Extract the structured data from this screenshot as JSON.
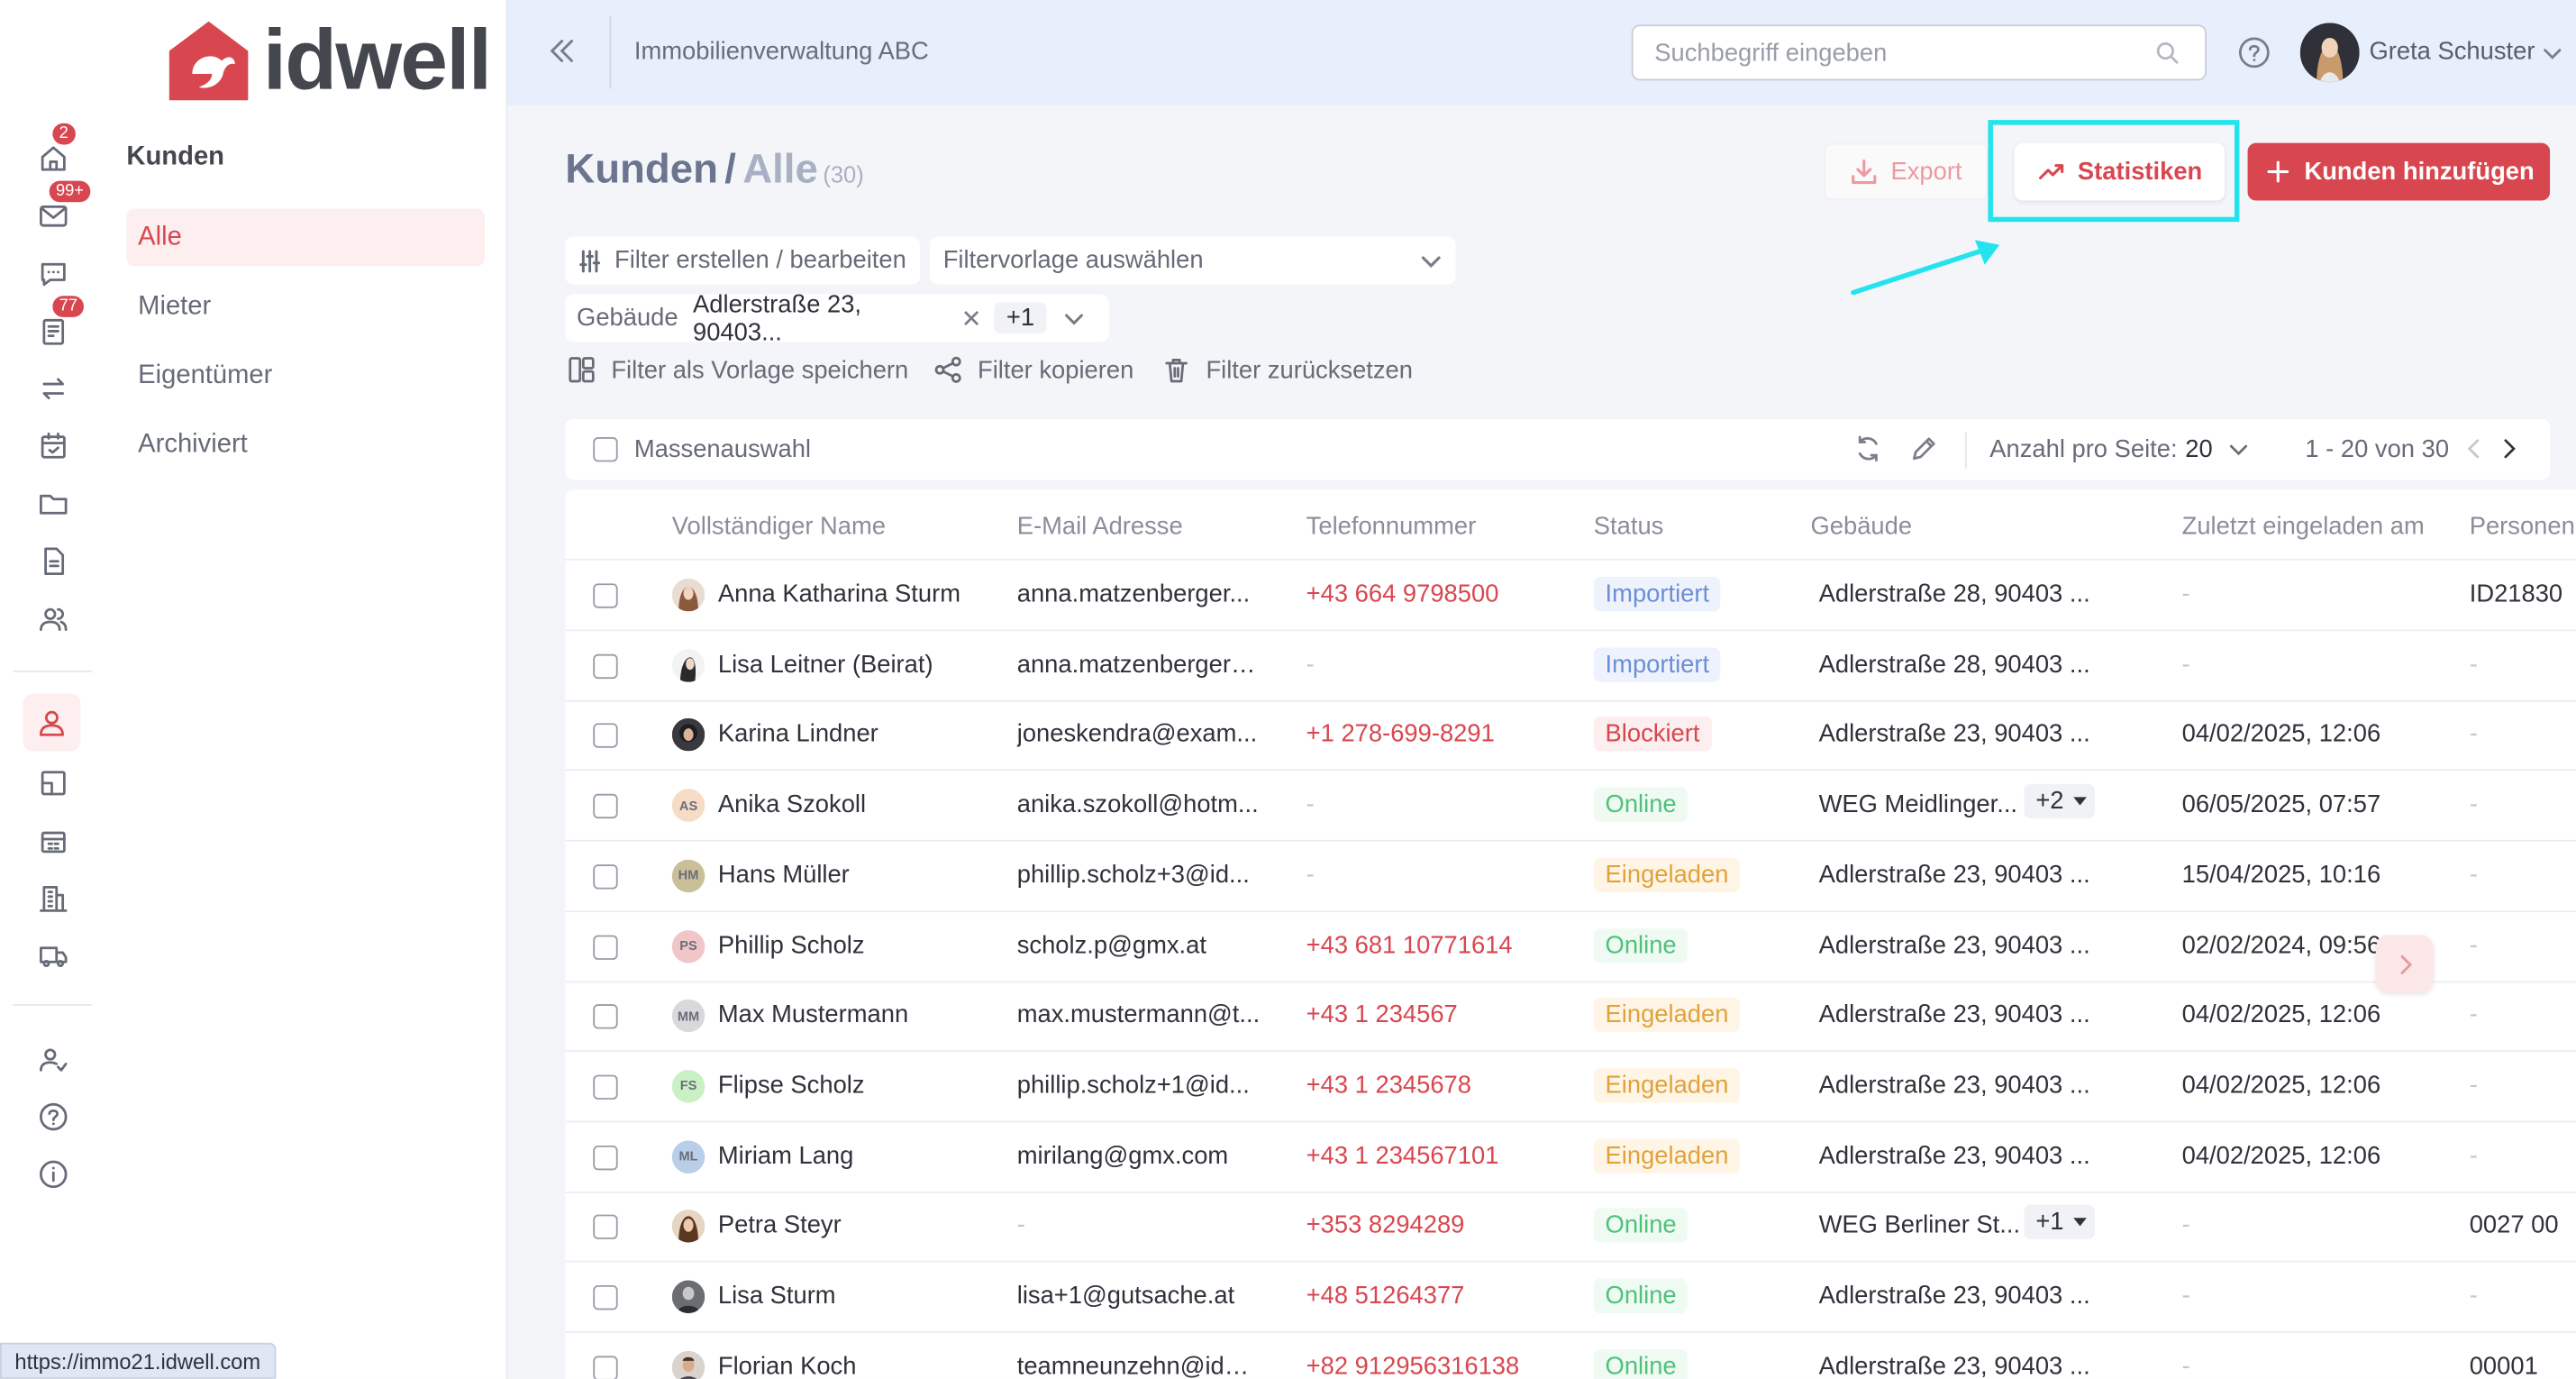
{
  "brand": {
    "name": "idwell",
    "primary": "#d8474f",
    "highlight": "#22e3ee"
  },
  "rail": {
    "badges": {
      "home": "2",
      "mail": "99+",
      "tickets": "77"
    }
  },
  "subnav": {
    "title": "Kunden",
    "items": [
      {
        "label": "Alle",
        "active": true
      },
      {
        "label": "Mieter",
        "active": false
      },
      {
        "label": "Eigentümer",
        "active": false
      },
      {
        "label": "Archiviert",
        "active": false
      }
    ]
  },
  "topbar": {
    "org": "Immobilienverwaltung ABC",
    "search_placeholder": "Suchbegriff eingeben",
    "user": "Greta Schuster"
  },
  "page": {
    "title": "Kunden",
    "separator": "/",
    "subtitle": "Alle",
    "count": "(30)",
    "export_label": "Export",
    "stats_label": "Statistiken",
    "add_label": "Kunden hinzufügen"
  },
  "filters": {
    "create_label": "Filter erstellen / bearbeiten",
    "template_placeholder": "Filtervorlage auswählen",
    "building_label": "Gebäude",
    "building_value": "Adlerstraße 23, 90403...",
    "building_more": "+1",
    "save_template": "Filter als Vorlage speichern",
    "copy": "Filter kopieren",
    "reset": "Filter zurücksetzen"
  },
  "toolbar": {
    "mass_select": "Massenauswahl",
    "per_page_label": "Anzahl pro Seite:",
    "per_page_value": "20",
    "range": "1 - 20 von 30"
  },
  "table": {
    "columns": [
      "Vollständiger Name",
      "E-Mail Adresse",
      "Telefonnummer",
      "Status",
      "Gebäude",
      "Zuletzt eingeladen am",
      "Personen"
    ],
    "rows": [
      {
        "avatar": "photo-f1",
        "name": "Anna Katharina Sturm",
        "email": "anna.matzenberger...",
        "phone": "+43 664 9798500",
        "status": "Importiert",
        "building": "Adlerstraße 28, 90403 ...",
        "more": "",
        "invited": "-",
        "person": "ID21830"
      },
      {
        "avatar": "photo-f2",
        "name": "Lisa Leitner (Beirat)",
        "email": "anna.matzenberger+...",
        "phone": "-",
        "status": "Importiert",
        "building": "Adlerstraße 28, 90403 ...",
        "more": "",
        "invited": "-",
        "person": "-"
      },
      {
        "avatar": "photo-f3",
        "name": "Karina Lindner",
        "email": "joneskendra@exam...",
        "phone": "+1 278-699-8291",
        "status": "Blockiert",
        "building": "Adlerstraße 23, 90403 ...",
        "more": "",
        "invited": "04/02/2025, 12:06",
        "person": "-"
      },
      {
        "avatar": "AS",
        "avatar_color": "#f6dcc4",
        "name": "Anika Szokoll",
        "email": "anika.szokoll@hotm...",
        "phone": "-",
        "status": "Online",
        "building": "WEG Meidlinger...",
        "more": "+2",
        "invited": "06/05/2025, 07:57",
        "person": "-"
      },
      {
        "avatar": "HM",
        "avatar_color": "#c9c09a",
        "name": "Hans Müller",
        "email": "phillip.scholz+3@id...",
        "phone": "-",
        "status": "Eingeladen",
        "building": "Adlerstraße 23, 90403 ...",
        "more": "",
        "invited": "15/04/2025, 10:16",
        "person": "-"
      },
      {
        "avatar": "PS",
        "avatar_color": "#f1c6c9",
        "name": "Phillip Scholz",
        "email": "scholz.p@gmx.at",
        "phone": "+43 681 10771614",
        "status": "Online",
        "building": "Adlerstraße 23, 90403 ...",
        "more": "",
        "invited": "02/02/2024, 09:56",
        "person": "-"
      },
      {
        "avatar": "MM",
        "avatar_color": "#d9d9dd",
        "name": "Max Mustermann",
        "email": "max.mustermann@t...",
        "phone": "+43 1 234567",
        "status": "Eingeladen",
        "building": "Adlerstraße 23, 90403 ...",
        "more": "",
        "invited": "04/02/2025, 12:06",
        "person": "-"
      },
      {
        "avatar": "FS",
        "avatar_color": "#c9f1c4",
        "name": "Flipse Scholz",
        "email": "phillip.scholz+1@id...",
        "phone": "+43 1 2345678",
        "status": "Eingeladen",
        "building": "Adlerstraße 23, 90403 ...",
        "more": "",
        "invited": "04/02/2025, 12:06",
        "person": "-"
      },
      {
        "avatar": "ML",
        "avatar_color": "#b9cfe9",
        "name": "Miriam Lang",
        "email": "mirilang@gmx.com",
        "phone": "+43 1 234567101",
        "status": "Eingeladen",
        "building": "Adlerstraße 23, 90403 ...",
        "more": "",
        "invited": "04/02/2025, 12:06",
        "person": "-"
      },
      {
        "avatar": "photo-f4",
        "name": "Petra Steyr",
        "email": "-",
        "phone": "+353 8294289",
        "status": "Online",
        "building": "WEG Berliner St...",
        "more": "+1",
        "invited": "-",
        "person": "0027 00"
      },
      {
        "avatar": "photo-m1",
        "name": "Lisa Sturm",
        "email": "lisa+1@gutsache.at",
        "phone": "+48 51264377",
        "status": "Online",
        "building": "Adlerstraße 23, 90403 ...",
        "more": "",
        "invited": "-",
        "person": "-"
      },
      {
        "avatar": "photo-m2",
        "name": "Florian Koch",
        "email": "teamneunzehn@idw...",
        "phone": "+82 912956316138",
        "status": "Online",
        "building": "Adlerstraße 23, 90403 ...",
        "more": "",
        "invited": "-",
        "person": "00001"
      }
    ]
  },
  "status_url": "https://immo21.idwell.com"
}
